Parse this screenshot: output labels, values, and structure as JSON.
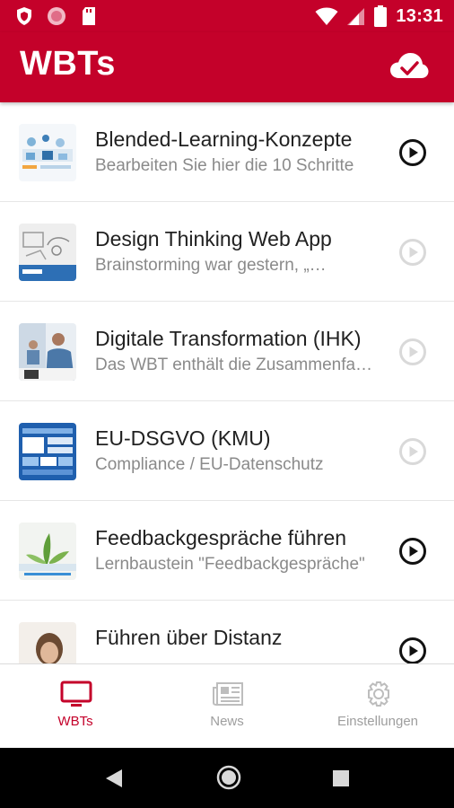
{
  "status_bar": {
    "time": "13:31",
    "icons": [
      "shield-icon",
      "record-dot-icon",
      "sd-card-icon",
      "wifi-icon",
      "signal-icon",
      "battery-icon"
    ]
  },
  "app_bar": {
    "title": "WBTs",
    "action_icon": "cloud-check-icon"
  },
  "colors": {
    "brand": "#c4012a",
    "title_text": "#212121",
    "subtitle_text": "#8a8a8a",
    "play_active": "#111111",
    "play_disabled": "#d9d9d9",
    "nav_active": "#c4012a",
    "nav_inactive": "#9e9e9e"
  },
  "wbts": [
    {
      "title": "Blended-Learning-Konzepte",
      "subtitle": "Bearbeiten Sie hier die 10 Schritte",
      "play_enabled": true
    },
    {
      "title": "Design Thinking Web App",
      "subtitle": "Brainstorming war gestern, „…",
      "play_enabled": false
    },
    {
      "title": "Digitale Transformation (IHK)",
      "subtitle": "Das WBT enthält die Zusammenfassung",
      "play_enabled": false
    },
    {
      "title": "EU-DSGVO (KMU)",
      "subtitle": "Compliance / EU-Datenschutz",
      "play_enabled": false
    },
    {
      "title": "Feedbackgespräche führen",
      "subtitle": "Lernbaustein \"Feedbackgespräche\"",
      "play_enabled": true
    },
    {
      "title": "Führen über Distanz",
      "subtitle": "",
      "play_enabled": true
    }
  ],
  "bottom_nav": {
    "items": [
      {
        "label": "WBTs",
        "icon": "monitor-icon",
        "active": true
      },
      {
        "label": "News",
        "icon": "newspaper-icon",
        "active": false
      },
      {
        "label": "Einstellungen",
        "icon": "gear-icon",
        "active": false
      }
    ]
  },
  "system_nav": {
    "icons": [
      "back-icon",
      "home-icon",
      "recents-icon"
    ]
  }
}
